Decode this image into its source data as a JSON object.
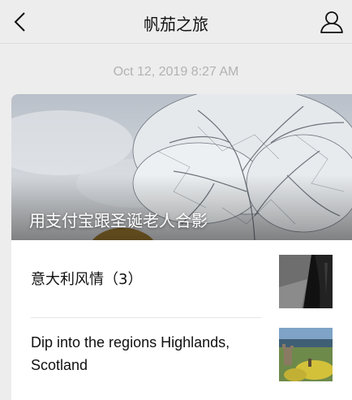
{
  "header": {
    "title": "帆茄之旅",
    "back_icon": "chevron-left-icon",
    "user_icon": "user-profile-icon"
  },
  "message": {
    "timestamp": "Oct 12, 2019 8:27 AM"
  },
  "article_card": {
    "hero": {
      "title": "用支付宝跟圣诞老人合影",
      "image": "snow-covered-tree-photo"
    },
    "items": [
      {
        "title": "意大利风情（3）",
        "thumbnail": "dark-street-photo"
      },
      {
        "title": "Dip into the regions Highlands, Scotland",
        "thumbnail": "scottish-castle-lake-photo"
      }
    ]
  },
  "colors": {
    "background": "#ededed",
    "card": "#ffffff",
    "timestamp": "#b2b2b2"
  }
}
